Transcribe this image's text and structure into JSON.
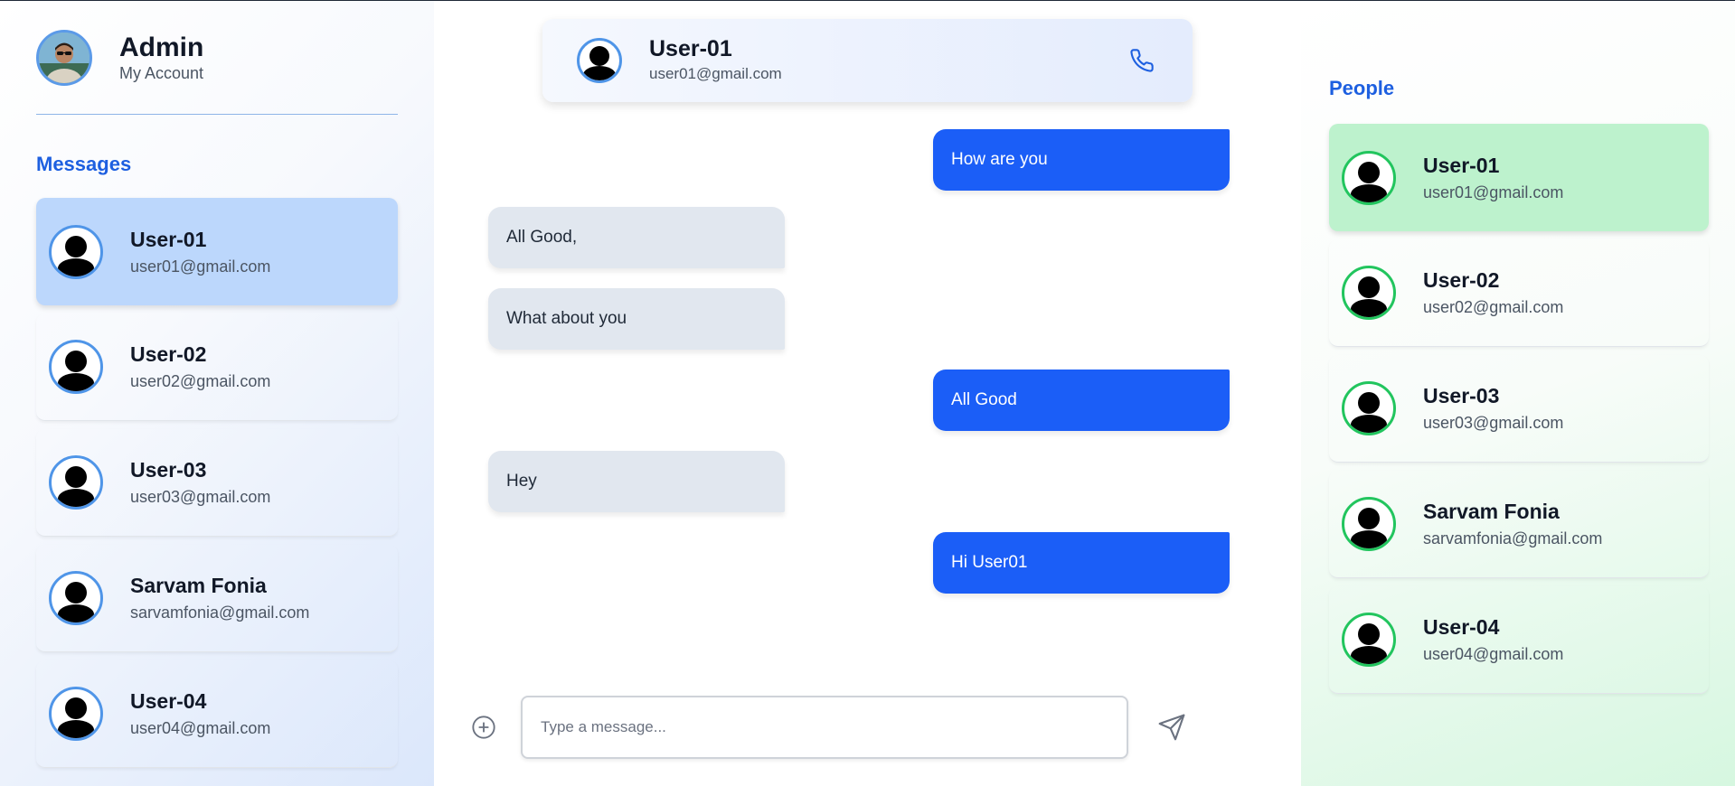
{
  "admin": {
    "name": "Admin",
    "subtitle": "My Account"
  },
  "messages_panel": {
    "title": "Messages",
    "contacts": [
      {
        "name": "User-01",
        "email": "user01@gmail.com",
        "active": true
      },
      {
        "name": "User-02",
        "email": "user02@gmail.com",
        "active": false
      },
      {
        "name": "User-03",
        "email": "user03@gmail.com",
        "active": false
      },
      {
        "name": "Sarvam Fonia",
        "email": "sarvamfonia@gmail.com",
        "active": false
      },
      {
        "name": "User-04",
        "email": "user04@gmail.com",
        "active": false
      }
    ]
  },
  "chat": {
    "header": {
      "name": "User-01",
      "email": "user01@gmail.com",
      "call_icon": "phone-icon"
    },
    "messages": [
      {
        "text": "How are you",
        "direction": "out"
      },
      {
        "text": "All Good,",
        "direction": "in"
      },
      {
        "text": "What about you",
        "direction": "in"
      },
      {
        "text": "All Good",
        "direction": "out"
      },
      {
        "text": "Hey",
        "direction": "in"
      },
      {
        "text": "Hi User01",
        "direction": "out"
      }
    ],
    "composer": {
      "placeholder": "Type a message...",
      "value": "",
      "add_icon": "plus-circle-icon",
      "send_icon": "send-icon"
    }
  },
  "people_panel": {
    "title": "People",
    "contacts": [
      {
        "name": "User-01",
        "email": "user01@gmail.com",
        "active": true
      },
      {
        "name": "User-02",
        "email": "user02@gmail.com",
        "active": false
      },
      {
        "name": "User-03",
        "email": "user03@gmail.com",
        "active": false
      },
      {
        "name": "Sarvam Fonia",
        "email": "sarvamfonia@gmail.com",
        "active": false
      },
      {
        "name": "User-04",
        "email": "user04@gmail.com",
        "active": false
      }
    ]
  },
  "colors": {
    "accent_blue": "#1b5ef7",
    "title_blue": "#1d5fe0",
    "active_message_bg": "#bcd7fc",
    "active_people_bg": "#bdf2cd",
    "incoming_bubble": "#e1e7ef",
    "people_ring": "#22c55e",
    "message_ring": "#4f95e8"
  }
}
